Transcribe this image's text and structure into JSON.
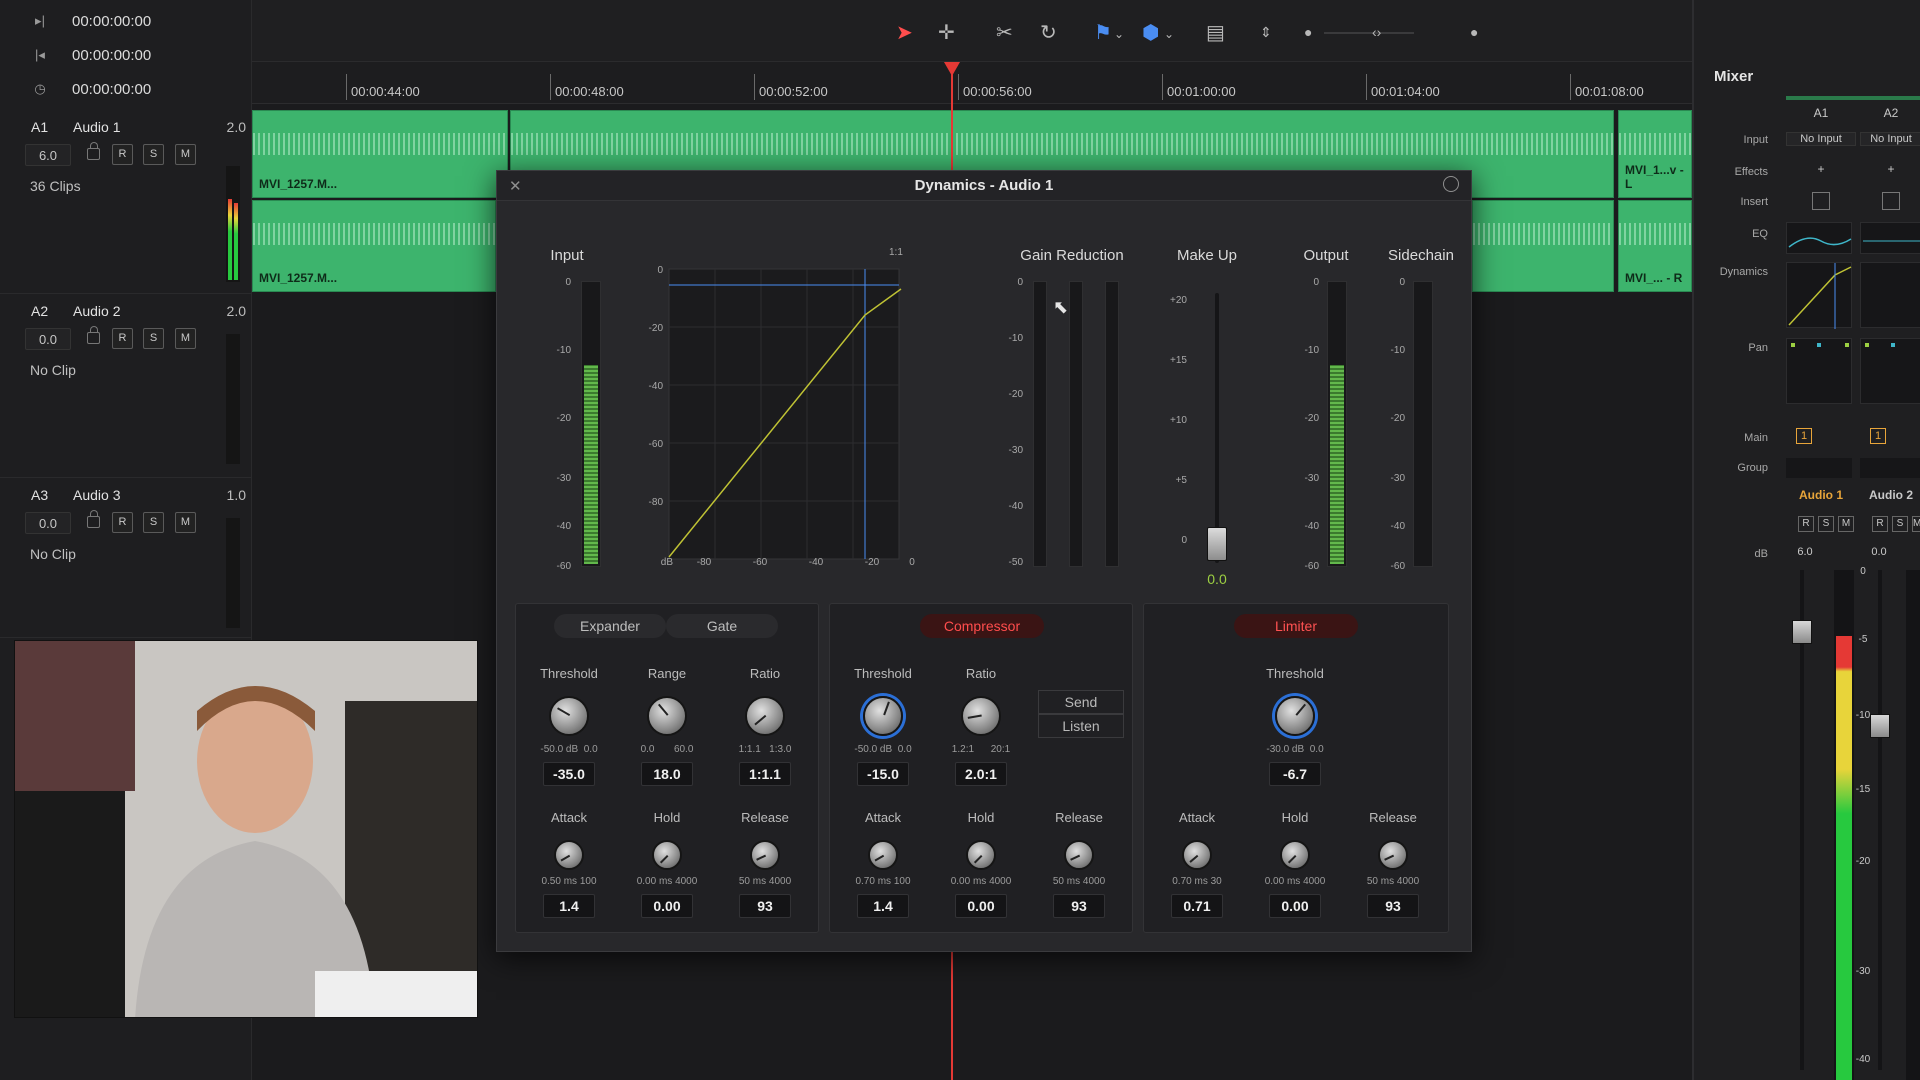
{
  "transport": {
    "timecodes": [
      "00:00:00:00",
      "00:00:00:00",
      "00:00:00:00"
    ]
  },
  "tracks": [
    {
      "id": "A1",
      "name": "Audio 1",
      "channels": "2.0",
      "volume": "6.0",
      "clips": "36 Clips",
      "buttons": [
        "R",
        "S",
        "M"
      ],
      "meter_level": 0.6
    },
    {
      "id": "A2",
      "name": "Audio 2",
      "channels": "2.0",
      "volume": "0.0",
      "clips": "No Clip",
      "buttons": [
        "R",
        "S",
        "M"
      ],
      "meter_level": 0
    },
    {
      "id": "A3",
      "name": "Audio 3",
      "channels": "1.0",
      "volume": "0.0",
      "clips": "No Clip",
      "buttons": [
        "R",
        "S",
        "M"
      ],
      "meter_level": 0
    }
  ],
  "ruler": [
    "00:00:44:00",
    "00:00:48:00",
    "00:00:52:00",
    "00:00:56:00",
    "00:01:00:00",
    "00:01:04:00",
    "00:01:08:00"
  ],
  "clips": {
    "left_top": "MVI_1257.M...",
    "left_bottom": "MVI_1257.M...",
    "right_top": "MVI_1...v - L",
    "right_bottom": "MVI_... - R"
  },
  "dynamics": {
    "title": "Dynamics - Audio 1",
    "sections": {
      "input": "Input",
      "gain_reduction": "Gain Reduction",
      "makeup": "Make Up",
      "output": "Output",
      "sidechain": "Sidechain"
    },
    "graph": {
      "ratio_label": "1:1",
      "y_ticks": [
        "0",
        "-20",
        "-40",
        "-60",
        "-80",
        "dB"
      ],
      "x_ticks": [
        "-80",
        "-60",
        "-40",
        "-20",
        "0"
      ]
    },
    "meter_scale": [
      "0",
      "-10",
      "-20",
      "-30",
      "-40",
      "-50"
    ],
    "input_scale": [
      "0",
      "-10",
      "-20",
      "-30",
      "-40",
      "-60"
    ],
    "makeup_scale": [
      "+20",
      "+15",
      "+10",
      "+5",
      "0"
    ],
    "makeup_value": "0.0",
    "output_scale": [
      "0",
      "-10",
      "-20",
      "-30",
      "-40",
      "-60"
    ],
    "sidechain_scale": [
      "0",
      "-10",
      "-20",
      "-30",
      "-40",
      "-60"
    ],
    "input_level": 0.7,
    "output_level": 0.7,
    "expander": {
      "tabs": [
        "Expander",
        "Gate"
      ],
      "row1": [
        {
          "label": "Threshold",
          "min": "-50.0 dB",
          "max": "0.0",
          "value": "-35.0"
        },
        {
          "label": "Range",
          "min": "0.0",
          "max": "60.0",
          "value": "18.0"
        },
        {
          "label": "Ratio",
          "min": "1:1.1",
          "max": "1:3.0",
          "value": "1:1.1"
        }
      ],
      "row2": [
        {
          "label": "Attack",
          "min": "0.50",
          "unit": "ms",
          "max": "100",
          "value": "1.4"
        },
        {
          "label": "Hold",
          "min": "0.00",
          "unit": "ms",
          "max": "4000",
          "value": "0.00"
        },
        {
          "label": "Release",
          "min": "50",
          "unit": "ms",
          "max": "4000",
          "value": "93"
        }
      ]
    },
    "compressor": {
      "tab": "Compressor",
      "row1": [
        {
          "label": "Threshold",
          "min": "-50.0 dB",
          "max": "0.0",
          "value": "-15.0"
        },
        {
          "label": "Ratio",
          "min": "1.2:1",
          "max": "20:1",
          "value": "2.0:1"
        }
      ],
      "send": "Send",
      "listen": "Listen",
      "row2": [
        {
          "label": "Attack",
          "min": "0.70",
          "unit": "ms",
          "max": "100",
          "value": "1.4"
        },
        {
          "label": "Hold",
          "min": "0.00",
          "unit": "ms",
          "max": "4000",
          "value": "0.00"
        },
        {
          "label": "Release",
          "min": "50",
          "unit": "ms",
          "max": "4000",
          "value": "93"
        }
      ]
    },
    "limiter": {
      "tab": "Limiter",
      "row1": [
        {
          "label": "Threshold",
          "min": "-30.0 dB",
          "max": "0.0",
          "value": "-6.7"
        }
      ],
      "row2": [
        {
          "label": "Attack",
          "min": "0.70",
          "unit": "ms",
          "max": "30",
          "value": "0.71"
        },
        {
          "label": "Hold",
          "min": "0.00",
          "unit": "ms",
          "max": "4000",
          "value": "0.00"
        },
        {
          "label": "Release",
          "min": "50",
          "unit": "ms",
          "max": "4000",
          "value": "93"
        }
      ]
    }
  },
  "mixer": {
    "title": "Mixer",
    "row_labels": {
      "input": "Input",
      "effects": "Effects",
      "insert": "Insert",
      "eq": "EQ",
      "dynamics": "Dynamics",
      "pan": "Pan",
      "main": "Main",
      "group": "Group",
      "db": "dB"
    },
    "channels": [
      {
        "id": "A1",
        "input": "No Input",
        "main": "1",
        "name": "Audio 1",
        "db": "6.0",
        "buttons": [
          "R",
          "S",
          "M"
        ]
      },
      {
        "id": "A2",
        "input": "No Input",
        "main": "1",
        "name": "Audio 2",
        "db": "0.0",
        "buttons": [
          "R",
          "S",
          "M"
        ]
      }
    ],
    "scale": [
      "0",
      "-5",
      "-10",
      "-15",
      "-20",
      "-30",
      "-40"
    ]
  },
  "colors": {
    "accent_red": "#ff4d4d",
    "clip_green": "#3db46d",
    "blue_line": "#4a8df2",
    "limiter_red": "#ff5252"
  }
}
